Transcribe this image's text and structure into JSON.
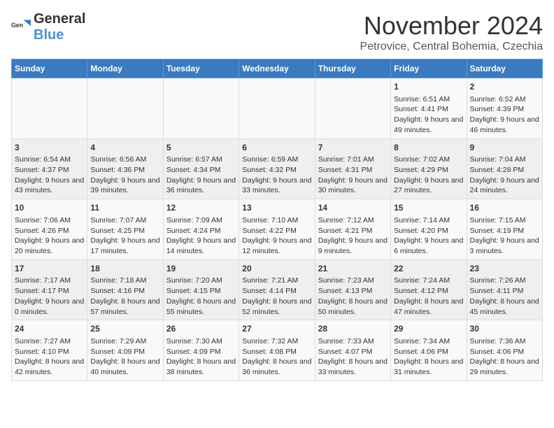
{
  "header": {
    "logo_general": "General",
    "logo_blue": "Blue",
    "month_title": "November 2024",
    "location": "Petrovice, Central Bohemia, Czechia"
  },
  "calendar": {
    "days_of_week": [
      "Sunday",
      "Monday",
      "Tuesday",
      "Wednesday",
      "Thursday",
      "Friday",
      "Saturday"
    ],
    "weeks": [
      [
        {
          "day": "",
          "content": ""
        },
        {
          "day": "",
          "content": ""
        },
        {
          "day": "",
          "content": ""
        },
        {
          "day": "",
          "content": ""
        },
        {
          "day": "",
          "content": ""
        },
        {
          "day": "1",
          "content": "Sunrise: 6:51 AM\nSunset: 4:41 PM\nDaylight: 9 hours and 49 minutes."
        },
        {
          "day": "2",
          "content": "Sunrise: 6:52 AM\nSunset: 4:39 PM\nDaylight: 9 hours and 46 minutes."
        }
      ],
      [
        {
          "day": "3",
          "content": "Sunrise: 6:54 AM\nSunset: 4:37 PM\nDaylight: 9 hours and 43 minutes."
        },
        {
          "day": "4",
          "content": "Sunrise: 6:56 AM\nSunset: 4:36 PM\nDaylight: 9 hours and 39 minutes."
        },
        {
          "day": "5",
          "content": "Sunrise: 6:57 AM\nSunset: 4:34 PM\nDaylight: 9 hours and 36 minutes."
        },
        {
          "day": "6",
          "content": "Sunrise: 6:59 AM\nSunset: 4:32 PM\nDaylight: 9 hours and 33 minutes."
        },
        {
          "day": "7",
          "content": "Sunrise: 7:01 AM\nSunset: 4:31 PM\nDaylight: 9 hours and 30 minutes."
        },
        {
          "day": "8",
          "content": "Sunrise: 7:02 AM\nSunset: 4:29 PM\nDaylight: 9 hours and 27 minutes."
        },
        {
          "day": "9",
          "content": "Sunrise: 7:04 AM\nSunset: 4:28 PM\nDaylight: 9 hours and 24 minutes."
        }
      ],
      [
        {
          "day": "10",
          "content": "Sunrise: 7:06 AM\nSunset: 4:26 PM\nDaylight: 9 hours and 20 minutes."
        },
        {
          "day": "11",
          "content": "Sunrise: 7:07 AM\nSunset: 4:25 PM\nDaylight: 9 hours and 17 minutes."
        },
        {
          "day": "12",
          "content": "Sunrise: 7:09 AM\nSunset: 4:24 PM\nDaylight: 9 hours and 14 minutes."
        },
        {
          "day": "13",
          "content": "Sunrise: 7:10 AM\nSunset: 4:22 PM\nDaylight: 9 hours and 12 minutes."
        },
        {
          "day": "14",
          "content": "Sunrise: 7:12 AM\nSunset: 4:21 PM\nDaylight: 9 hours and 9 minutes."
        },
        {
          "day": "15",
          "content": "Sunrise: 7:14 AM\nSunset: 4:20 PM\nDaylight: 9 hours and 6 minutes."
        },
        {
          "day": "16",
          "content": "Sunrise: 7:15 AM\nSunset: 4:19 PM\nDaylight: 9 hours and 3 minutes."
        }
      ],
      [
        {
          "day": "17",
          "content": "Sunrise: 7:17 AM\nSunset: 4:17 PM\nDaylight: 9 hours and 0 minutes."
        },
        {
          "day": "18",
          "content": "Sunrise: 7:18 AM\nSunset: 4:16 PM\nDaylight: 8 hours and 57 minutes."
        },
        {
          "day": "19",
          "content": "Sunrise: 7:20 AM\nSunset: 4:15 PM\nDaylight: 8 hours and 55 minutes."
        },
        {
          "day": "20",
          "content": "Sunrise: 7:21 AM\nSunset: 4:14 PM\nDaylight: 8 hours and 52 minutes."
        },
        {
          "day": "21",
          "content": "Sunrise: 7:23 AM\nSunset: 4:13 PM\nDaylight: 8 hours and 50 minutes."
        },
        {
          "day": "22",
          "content": "Sunrise: 7:24 AM\nSunset: 4:12 PM\nDaylight: 8 hours and 47 minutes."
        },
        {
          "day": "23",
          "content": "Sunrise: 7:26 AM\nSunset: 4:11 PM\nDaylight: 8 hours and 45 minutes."
        }
      ],
      [
        {
          "day": "24",
          "content": "Sunrise: 7:27 AM\nSunset: 4:10 PM\nDaylight: 8 hours and 42 minutes."
        },
        {
          "day": "25",
          "content": "Sunrise: 7:29 AM\nSunset: 4:09 PM\nDaylight: 8 hours and 40 minutes."
        },
        {
          "day": "26",
          "content": "Sunrise: 7:30 AM\nSunset: 4:09 PM\nDaylight: 8 hours and 38 minutes."
        },
        {
          "day": "27",
          "content": "Sunrise: 7:32 AM\nSunset: 4:08 PM\nDaylight: 8 hours and 36 minutes."
        },
        {
          "day": "28",
          "content": "Sunrise: 7:33 AM\nSunset: 4:07 PM\nDaylight: 8 hours and 33 minutes."
        },
        {
          "day": "29",
          "content": "Sunrise: 7:34 AM\nSunset: 4:06 PM\nDaylight: 8 hours and 31 minutes."
        },
        {
          "day": "30",
          "content": "Sunrise: 7:36 AM\nSunset: 4:06 PM\nDaylight: 8 hours and 29 minutes."
        }
      ]
    ]
  }
}
